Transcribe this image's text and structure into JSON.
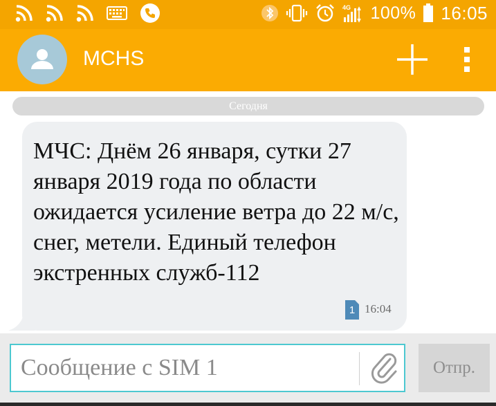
{
  "status_bar": {
    "left_icons": [
      "rss-icon",
      "rss-icon",
      "rss-icon",
      "keyboard-icon",
      "phone-icon"
    ],
    "right_icons": [
      "bluetooth-icon",
      "vibrate-icon",
      "alarm-icon",
      "signal-4g-icon"
    ],
    "network": "4G",
    "battery": "100%",
    "time": "16:05"
  },
  "header": {
    "contact_name": "MCHS",
    "avatar_icon": "person-icon",
    "add_icon": "plus-icon",
    "menu_icon": "more-vert-icon"
  },
  "conversation": {
    "date_divider": "Сегодня",
    "messages": [
      {
        "text": "МЧС: Днём 26 января, сутки 27 января 2019 года по области ожидается усиление ветра до 22 м/с, снег, метели. Единый телефон экстренных служб-112",
        "sim": "1",
        "time": "16:04"
      }
    ]
  },
  "compose": {
    "placeholder": "Сообщение с SIM 1",
    "value": "",
    "attach_icon": "paperclip-icon",
    "send_label": "Отпр."
  },
  "colors": {
    "status_bar": "#f4a500",
    "app_bar": "#fbab02",
    "bubble": "#eef0f2",
    "input_border": "#4cc8d0",
    "sim_badge": "#4e8ab8"
  }
}
